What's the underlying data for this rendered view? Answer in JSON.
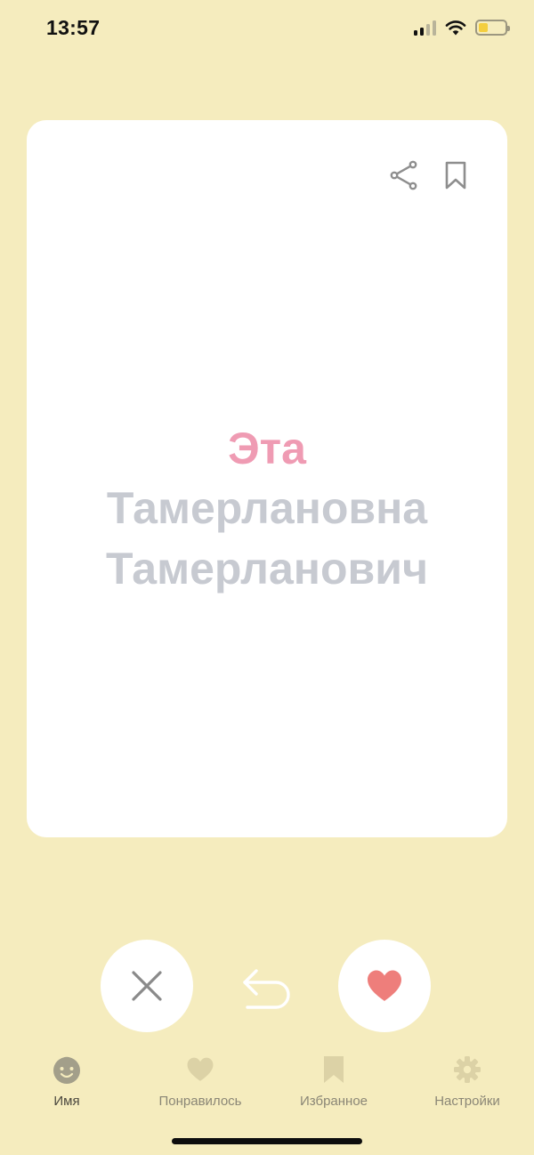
{
  "status_bar": {
    "time": "13:57",
    "signal_icon": "cellular-signal-icon",
    "wifi_icon": "wifi-icon",
    "battery_icon": "battery-icon",
    "battery_level": 0.35
  },
  "card": {
    "share_icon": "share-icon",
    "bookmark_icon": "bookmark-icon",
    "first_name": "Эта",
    "patronymic": "Тамерлановна",
    "surname": "Тамерланович"
  },
  "actions": {
    "dislike_icon": "close-icon",
    "undo_icon": "undo-arrow-icon",
    "like_icon": "heart-icon"
  },
  "tabs": [
    {
      "label": "Имя",
      "icon": "baby-face-icon",
      "active": true
    },
    {
      "label": "Понравилось",
      "icon": "heart-icon",
      "active": false
    },
    {
      "label": "Избранное",
      "icon": "bookmark-icon",
      "active": false
    },
    {
      "label": "Настройки",
      "icon": "gear-icon",
      "active": false
    }
  ],
  "colors": {
    "background": "#F5ECBE",
    "accent_pink": "#EF9BB3",
    "like_red": "#EE7E7B",
    "name_gray": "#C7CAD1"
  }
}
